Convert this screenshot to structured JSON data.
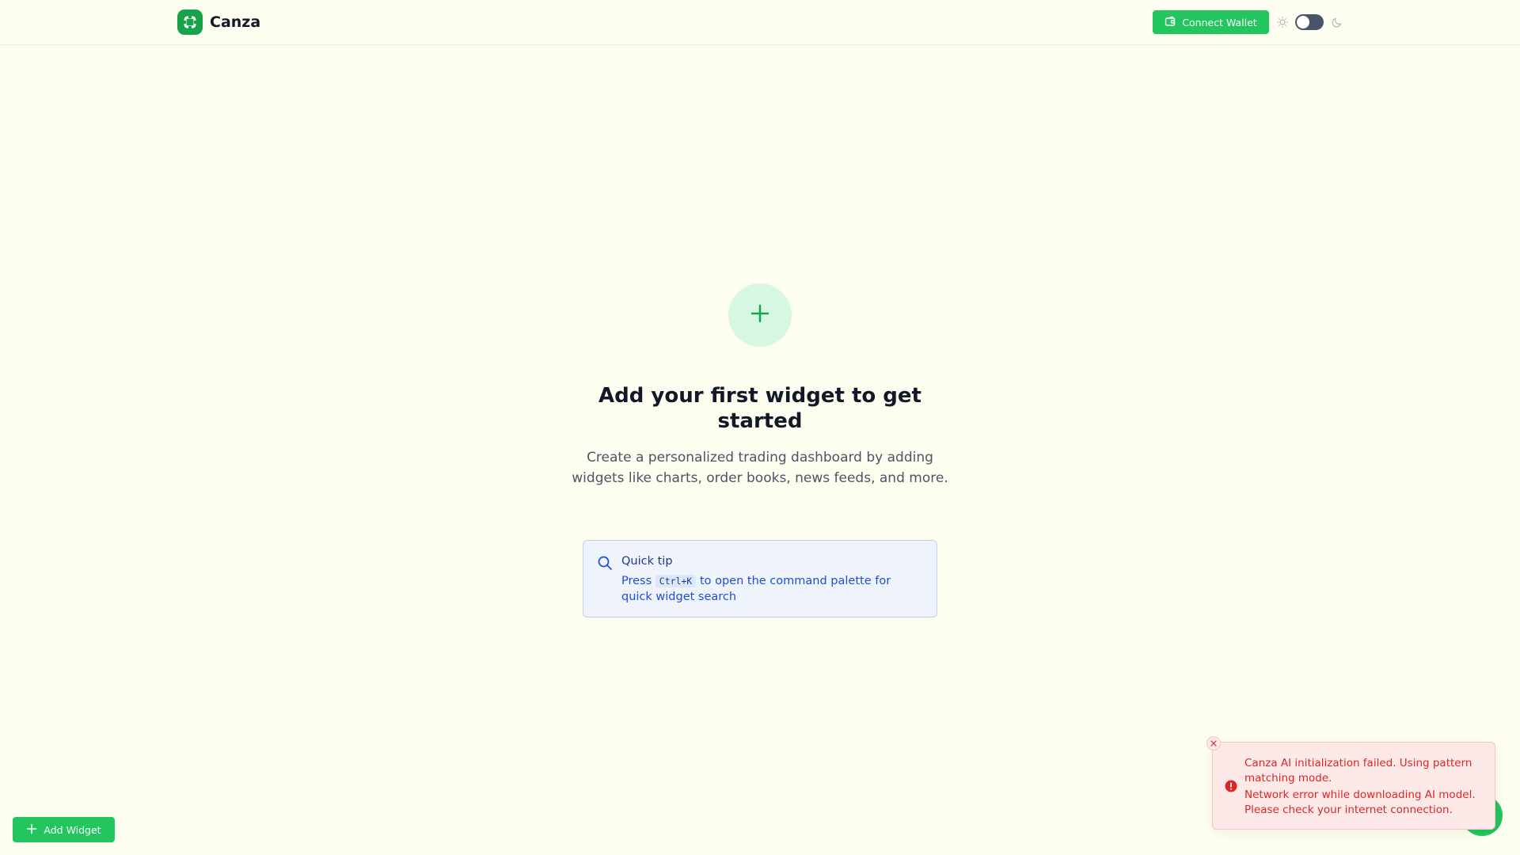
{
  "header": {
    "brand_name": "Canza",
    "connect_wallet_label": "Connect Wallet",
    "theme_mode": "light"
  },
  "empty_state": {
    "title": "Add your first widget to get started",
    "description": "Create a personalized trading dashboard by adding widgets like charts, order books, news feeds, and more."
  },
  "tip": {
    "title": "Quick tip",
    "prefix": "Press",
    "shortcut": "Ctrl+K",
    "suffix": "to open the command palette for quick widget search"
  },
  "footer": {
    "add_widget_label": "Add Widget"
  },
  "toast": {
    "message": "Canza AI initialization failed. Using pattern matching mode.",
    "detail": "Network error while downloading AI model. Please check your internet connection."
  },
  "colors": {
    "background": "#fefef0",
    "accent": "#22c55e",
    "brand": "#16a34a",
    "error": "#dc2626",
    "tip_text": "#1d4ed8"
  },
  "icons": {
    "logo": "canza-logo-icon",
    "wallet": "wallet-icon",
    "sun": "sun-icon",
    "moon": "moon-icon",
    "plus": "plus-icon",
    "search": "search-icon",
    "error": "alert-circle-icon",
    "close": "close-icon"
  }
}
